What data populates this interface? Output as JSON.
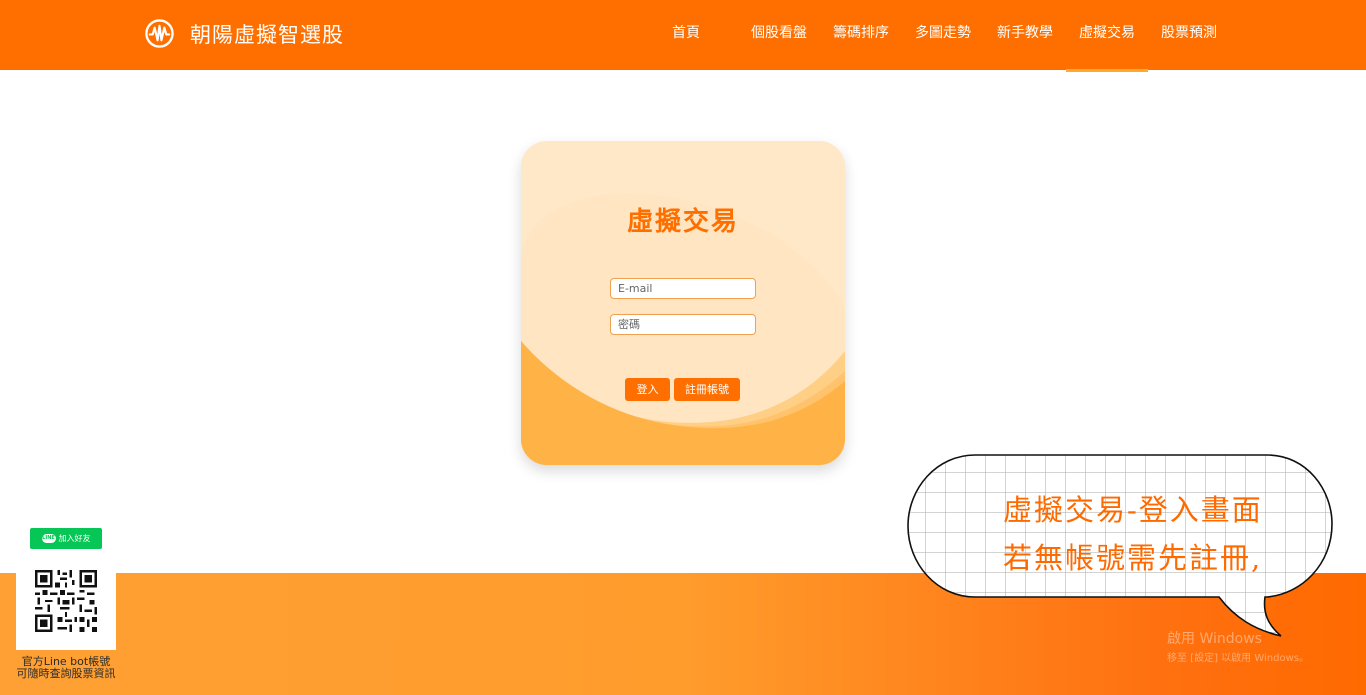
{
  "header": {
    "site_title": "朝陽虛擬智選股",
    "logo_icon": "pulse-logo-icon",
    "nav": [
      {
        "label": "首頁"
      },
      {
        "label": "個股看盤"
      },
      {
        "label": "籌碼排序"
      },
      {
        "label": "多圖走勢"
      },
      {
        "label": "新手教學"
      },
      {
        "label": "虛擬交易",
        "active": true
      },
      {
        "label": "股票預測"
      }
    ]
  },
  "login": {
    "title": "虛擬交易",
    "email_placeholder": "E-mail",
    "password_placeholder": "密碼",
    "login_label": "登入",
    "register_label": "註冊帳號"
  },
  "line_widget": {
    "add_friend_label": "加入好友",
    "logo_text": "LINE",
    "caption_line1": "官方Line bot帳號",
    "caption_line2": "可隨時查詢股票資訊"
  },
  "annotation": {
    "line1": "虛擬交易-登入畫面",
    "line2": "若無帳號需先註冊,"
  },
  "watermark": {
    "line1": "啟用 Windows",
    "line2": "移至 [設定] 以啟用 Windows。"
  },
  "colors": {
    "brand_orange": "#ff6f00",
    "card_bg": "#ffe5c2",
    "line_green": "#06c755"
  }
}
